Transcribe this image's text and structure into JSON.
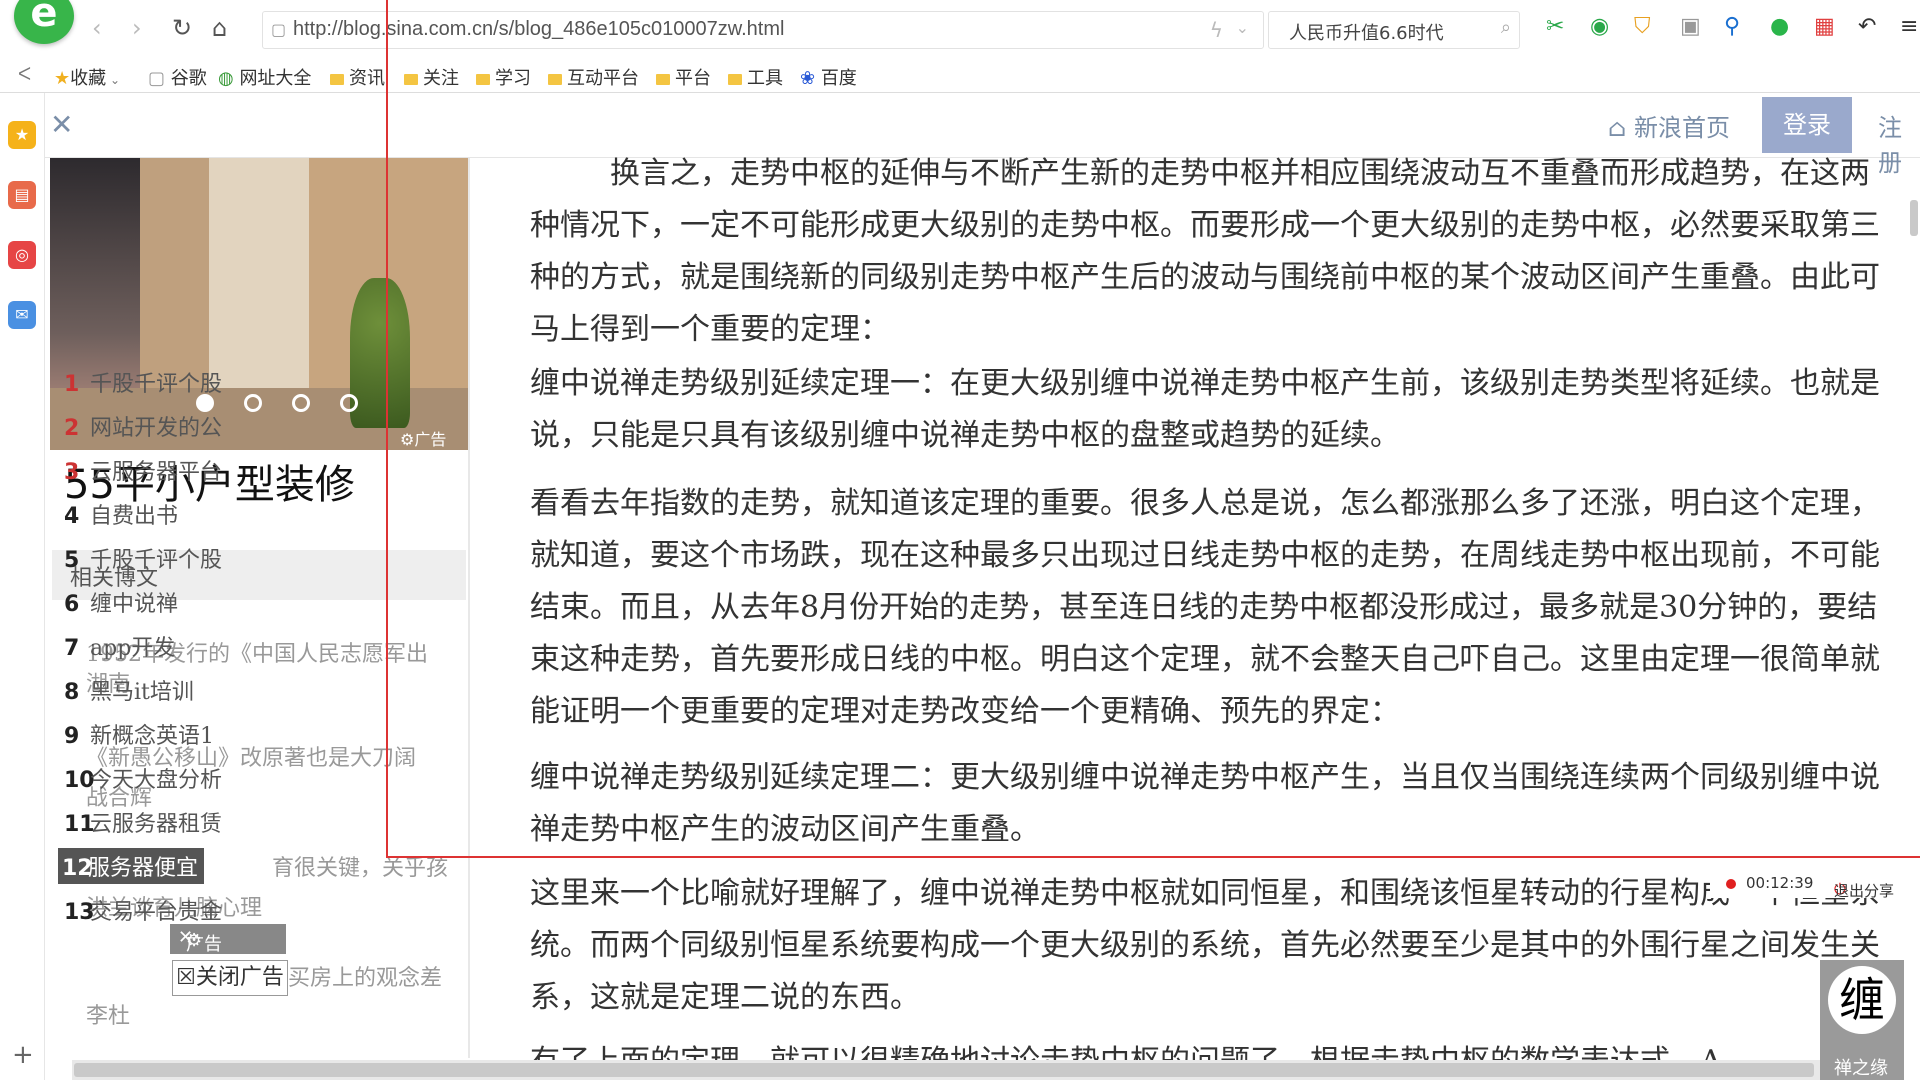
{
  "browser": {
    "url": "http://blog.sina.com.cn/s/blog_486e105c010007zw.html",
    "search_value": "人民币升值6.6时代"
  },
  "bookmarks": [
    {
      "label": "收藏",
      "icon": "star-icon"
    },
    {
      "label": "谷歌",
      "icon": "page-icon"
    },
    {
      "label": "网址大全",
      "icon": "globe-icon"
    },
    {
      "label": "资讯",
      "icon": "folder-icon"
    },
    {
      "label": "关注",
      "icon": "folder-icon"
    },
    {
      "label": "学习",
      "icon": "folder-icon"
    },
    {
      "label": "互动平台",
      "icon": "folder-icon"
    },
    {
      "label": "平台",
      "icon": "folder-icon"
    },
    {
      "label": "工具",
      "icon": "folder-icon"
    },
    {
      "label": "百度",
      "icon": "baidu-icon"
    }
  ],
  "sina": {
    "home_label": "新浪首页",
    "login_label": "登录",
    "register_label": "注册"
  },
  "ad": {
    "tag": "广告",
    "title": "55平小户型装修",
    "close_tag": "广告",
    "close_label": "关闭广告"
  },
  "hot_list": [
    {
      "num": "1",
      "label": "千股千评个股"
    },
    {
      "num": "2",
      "label": "网站开发的公"
    },
    {
      "num": "3",
      "label": "云服务器平台"
    },
    {
      "num": "4",
      "label": "自费出书"
    },
    {
      "num": "5",
      "label": "千股千评个股"
    },
    {
      "num": "6",
      "label": "缠中说禅"
    },
    {
      "num": "7",
      "label": "app开发"
    },
    {
      "num": "8",
      "label": "黑马it培训"
    },
    {
      "num": "9",
      "label": "新概念英语1"
    },
    {
      "num": "10",
      "label": "今天大盘分析"
    },
    {
      "num": "11",
      "label": "云服务器租赁"
    },
    {
      "num": "12",
      "label": "服务器便宜"
    },
    {
      "num": "13",
      "label": "交易平台贵金"
    }
  ],
  "related": {
    "heading": "相关博文",
    "items": [
      "1952年发行的《中国人民志愿军出",
      "湖南",
      "《新愚公移山》改原著也是大刀阔",
      "战合辉",
      "育很关键，关乎孩",
      "洪兰谈育儿脑心理",
      "买房上的观念差",
      "李杜"
    ]
  },
  "article": {
    "paragraphs": [
      "换言之，走势中枢的延伸与不断产生新的走势中枢并相应围绕波动互不重叠而形成趋势，在这两种情况下，一定不可能形成更大级别的走势中枢。而要形成一个更大级别的走势中枢，必然要采取第三种的方式，就是围绕新的同级别走势中枢产生后的波动与围绕前中枢的某个波动区间产生重叠。由此可马上得到一个重要的定理：",
      "缠中说禅走势级别延续定理一：在更大级别缠中说禅走势中枢产生前，该级别走势类型将延续。也就是说，只能是只具有该级别缠中说禅走势中枢的盘整或趋势的延续。",
      "看看去年指数的走势，就知道该定理的重要。很多人总是说，怎么都涨那么多了还涨，明白这个定理，就知道，要这个市场跌，现在这种最多只出现过日线走势中枢的走势，在周线走势中枢出现前，不可能结束。而且，从去年8月份开始的走势，甚至连日线的走势中枢都没形成过，最多就是30分钟的，要结束这种走势，首先要形成日线的中枢。明白这个定理，就不会整天自己吓自己。这里由定理一很简单就能证明一个更重要的定理对走势改变给一个更精确、预先的界定：",
      "缠中说禅走势级别延续定理二：更大级别缠中说禅走势中枢产生，当且仅当围绕连续两个同级别缠中说禅走势中枢产生的波动区间产生重叠。",
      "这里来一个比喻就好理解了，缠中说禅走势中枢就如同恒星，和围绕该恒星转动的行星构成一个恒星系统。而两个同级别恒星系统要构成一个更大级别的系统，首先必然要至少是其中的外围行星之间发生关系，这就是定理二说的东西。",
      "有了上面的定理，就可以很精确地讨论走势中枢的问题了。根据走势中枢的数学表达式，A"
    ]
  },
  "recorder": {
    "time": "00:12:39",
    "exit_label": "退出分享"
  },
  "chan_logo": {
    "glyph": "缠",
    "caption": "禅之缘"
  }
}
